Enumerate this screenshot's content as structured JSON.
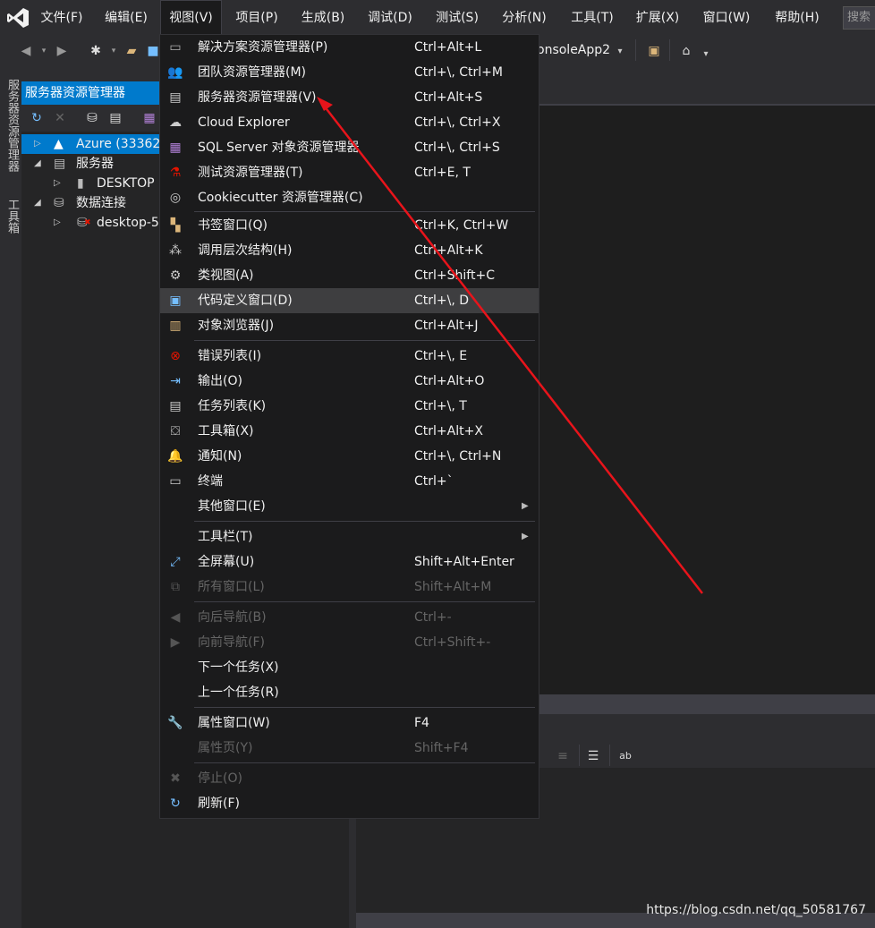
{
  "menubar": {
    "items": [
      "文件(F)",
      "编辑(E)",
      "视图(V)",
      "项目(P)",
      "生成(B)",
      "调试(D)",
      "测试(S)",
      "分析(N)",
      "工具(T)",
      "扩展(X)",
      "窗口(W)",
      "帮助(H)"
    ],
    "search_placeholder": "搜索"
  },
  "toolbar": {
    "project_combo": "onsoleApp2"
  },
  "left_tabs": [
    "服务器资源管理器",
    "工具箱"
  ],
  "server_explorer": {
    "title": "服务器资源管理器",
    "tree": [
      {
        "label": "Azure (33362",
        "expanded": false,
        "selected": true,
        "icon": "azure-icon"
      },
      {
        "label": "服务器",
        "expanded": true,
        "icon": "servers-icon"
      },
      {
        "label": "DESKTOP",
        "expanded": false,
        "icon": "server-machine-icon"
      },
      {
        "label": "数据连接",
        "expanded": true,
        "icon": "data-connections-icon"
      },
      {
        "label": "desktop-5",
        "expanded": false,
        "icon": "database-error-icon"
      }
    ]
  },
  "view_menu": {
    "items": [
      {
        "label": "解决方案资源管理器(P)",
        "shortcut": "Ctrl+Alt+L",
        "icon": "solution-explorer-icon"
      },
      {
        "label": "团队资源管理器(M)",
        "shortcut": "Ctrl+\\, Ctrl+M",
        "icon": "team-explorer-icon"
      },
      {
        "label": "服务器资源管理器(V)",
        "shortcut": "Ctrl+Alt+S",
        "icon": "server-explorer-icon"
      },
      {
        "label": "Cloud Explorer",
        "shortcut": "Ctrl+\\, Ctrl+X",
        "icon": "cloud-icon"
      },
      {
        "label": "SQL Server 对象资源管理器",
        "shortcut": "Ctrl+\\, Ctrl+S",
        "icon": "sql-server-icon"
      },
      {
        "label": "测试资源管理器(T)",
        "shortcut": "Ctrl+E, T",
        "icon": "test-explorer-icon"
      },
      {
        "label": "Cookiecutter 资源管理器(C)",
        "shortcut": "",
        "icon": "cookiecutter-icon"
      },
      {
        "label": "书签窗口(Q)",
        "shortcut": "Ctrl+K, Ctrl+W",
        "icon": "bookmark-icon"
      },
      {
        "label": "调用层次结构(H)",
        "shortcut": "Ctrl+Alt+K",
        "icon": "call-hierarchy-icon"
      },
      {
        "label": "类视图(A)",
        "shortcut": "Ctrl+Shift+C",
        "icon": "class-view-icon"
      },
      {
        "label": "代码定义窗口(D)",
        "shortcut": "Ctrl+\\, D",
        "icon": "code-definition-icon",
        "highlighted": true
      },
      {
        "label": "对象浏览器(J)",
        "shortcut": "Ctrl+Alt+J",
        "icon": "object-browser-icon"
      },
      {
        "label": "错误列表(I)",
        "shortcut": "Ctrl+\\, E",
        "icon": "error-list-icon"
      },
      {
        "label": "输出(O)",
        "shortcut": "Ctrl+Alt+O",
        "icon": "output-icon"
      },
      {
        "label": "任务列表(K)",
        "shortcut": "Ctrl+\\, T",
        "icon": "task-list-icon"
      },
      {
        "label": "工具箱(X)",
        "shortcut": "Ctrl+Alt+X",
        "icon": "toolbox-icon"
      },
      {
        "label": "通知(N)",
        "shortcut": "Ctrl+\\, Ctrl+N",
        "icon": "bell-icon"
      },
      {
        "label": "终端",
        "shortcut": "Ctrl+`",
        "icon": "terminal-icon"
      },
      {
        "label": "其他窗口(E)",
        "shortcut": "",
        "icon": "",
        "submenu": true
      },
      {
        "label": "工具栏(T)",
        "shortcut": "",
        "icon": "",
        "submenu": true
      },
      {
        "label": "全屏幕(U)",
        "shortcut": "Shift+Alt+Enter",
        "icon": "fullscreen-icon"
      },
      {
        "label": "所有窗口(L)",
        "shortcut": "Shift+Alt+M",
        "icon": "all-windows-icon",
        "disabled": true
      },
      {
        "label": "向后导航(B)",
        "shortcut": "Ctrl+-",
        "icon": "navigate-back-icon",
        "disabled": true
      },
      {
        "label": "向前导航(F)",
        "shortcut": "Ctrl+Shift+-",
        "icon": "navigate-forward-icon",
        "disabled": true
      },
      {
        "label": "下一个任务(X)",
        "shortcut": "",
        "icon": ""
      },
      {
        "label": "上一个任务(R)",
        "shortcut": "",
        "icon": ""
      },
      {
        "label": "属性窗口(W)",
        "shortcut": "F4",
        "icon": "wrench-icon"
      },
      {
        "label": "属性页(Y)",
        "shortcut": "Shift+F4",
        "icon": "",
        "disabled": true
      },
      {
        "label": "停止(O)",
        "shortcut": "",
        "icon": "stop-icon",
        "disabled": true
      },
      {
        "label": "刷新(F)",
        "shortcut": "",
        "icon": "refresh-icon"
      }
    ]
  },
  "watermark": "https://blog.csdn.net/qq_50581767",
  "colors": {
    "accent": "#007acc",
    "menu_bg": "#1b1b1c",
    "highlight": "#3e3e40",
    "arrow": "#e8141b"
  }
}
